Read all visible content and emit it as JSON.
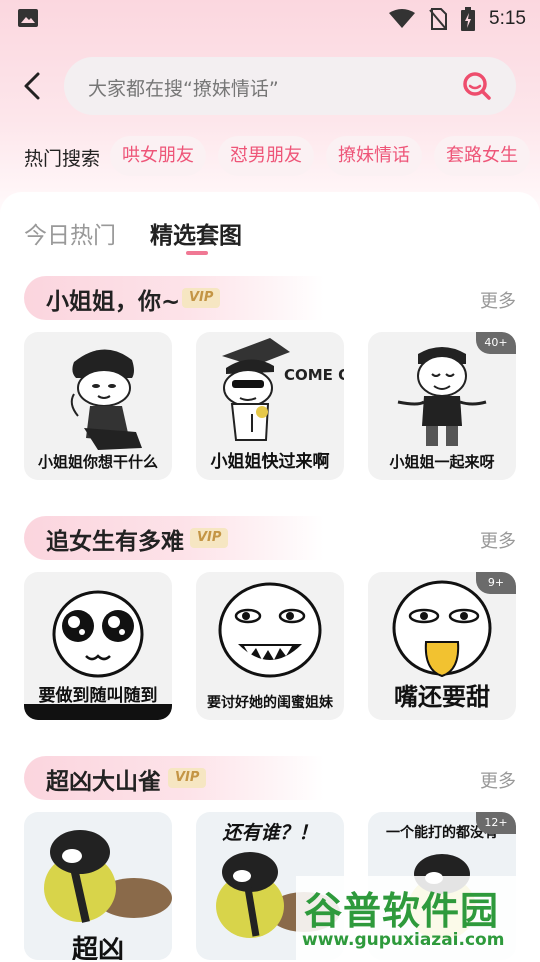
{
  "status_bar": {
    "time": "5:15",
    "icons": [
      "gallery-icon",
      "wifi-icon",
      "no-sim-icon",
      "battery-icon"
    ]
  },
  "search": {
    "placeholder": "大家都在搜“撩妹情话”"
  },
  "hot_search": {
    "label": "热门搜索",
    "chips": [
      "哄女朋友",
      "怼男朋友",
      "撩妹情话",
      "套路女生"
    ]
  },
  "tabs": [
    {
      "label": "今日热门",
      "active": false
    },
    {
      "label": "精选套图",
      "active": true
    }
  ],
  "sections": [
    {
      "title": "小姐姐，你~",
      "vip": "VIP",
      "more": "更多",
      "cards": [
        {
          "caption": "小姐姐你想干什么",
          "badge": ""
        },
        {
          "caption": "小姐姐快过来啊",
          "sticker_text": "COME ON",
          "badge": ""
        },
        {
          "caption": "小姐姐一起来呀",
          "badge": "40+"
        }
      ]
    },
    {
      "title": "追女生有多难",
      "vip": "VIP",
      "more": "更多",
      "cards": [
        {
          "caption": "要做到随叫随到",
          "badge": ""
        },
        {
          "caption": "要讨好她的闺蜜姐妹",
          "badge": ""
        },
        {
          "caption": "嘴还要甜",
          "badge": "9+"
        }
      ]
    },
    {
      "title": "超凶大山雀",
      "vip": "VIP",
      "more": "更多",
      "cards": [
        {
          "caption": "超凶",
          "badge": ""
        },
        {
          "caption": "还有谁？！",
          "badge": ""
        },
        {
          "caption": "一个能打的都没有",
          "badge": "12+"
        }
      ]
    }
  ],
  "watermark": {
    "title": "谷普软件园",
    "url": "www.gupuxiazai.com"
  },
  "colors": {
    "accent": "#ee5578",
    "vip_text": "#c49545",
    "badge_bg": "#6b6b6b",
    "watermark": "#2e9a3c"
  }
}
